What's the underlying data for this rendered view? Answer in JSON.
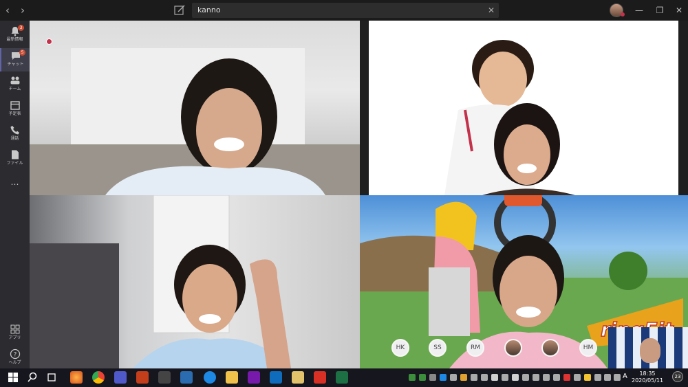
{
  "titlebar": {
    "back_icon": "chevron-left-icon",
    "forward_icon": "chevron-right-icon",
    "search_value": "kanno",
    "clear_label": "✕",
    "minimize": "—",
    "restore": "❐",
    "close": "✕"
  },
  "sidebar": {
    "items": [
      {
        "icon": "bell-icon",
        "label": "最新情報",
        "badge": "3"
      },
      {
        "icon": "chat-icon",
        "label": "チャット",
        "badge": "5"
      },
      {
        "icon": "teams-icon",
        "label": "チーム",
        "badge": ""
      },
      {
        "icon": "calendar-icon",
        "label": "予定表",
        "badge": ""
      },
      {
        "icon": "phone-icon",
        "label": "通話",
        "badge": ""
      },
      {
        "icon": "file-icon",
        "label": "ファイル",
        "badge": ""
      },
      {
        "icon": "more-icon",
        "label": "…",
        "badge": ""
      }
    ],
    "bottom": [
      {
        "icon": "apps-icon",
        "label": "アプリ"
      },
      {
        "icon": "help-icon",
        "label": "ヘルプ"
      }
    ]
  },
  "participants": [
    "HK",
    "SS",
    "RM",
    "HM"
  ],
  "video_overlay": {
    "game_text": "ringFit"
  },
  "taskbar": {
    "clock_time": "18:35",
    "clock_date": "2020/05/11",
    "input_mode": "A",
    "notification_count": "23"
  }
}
